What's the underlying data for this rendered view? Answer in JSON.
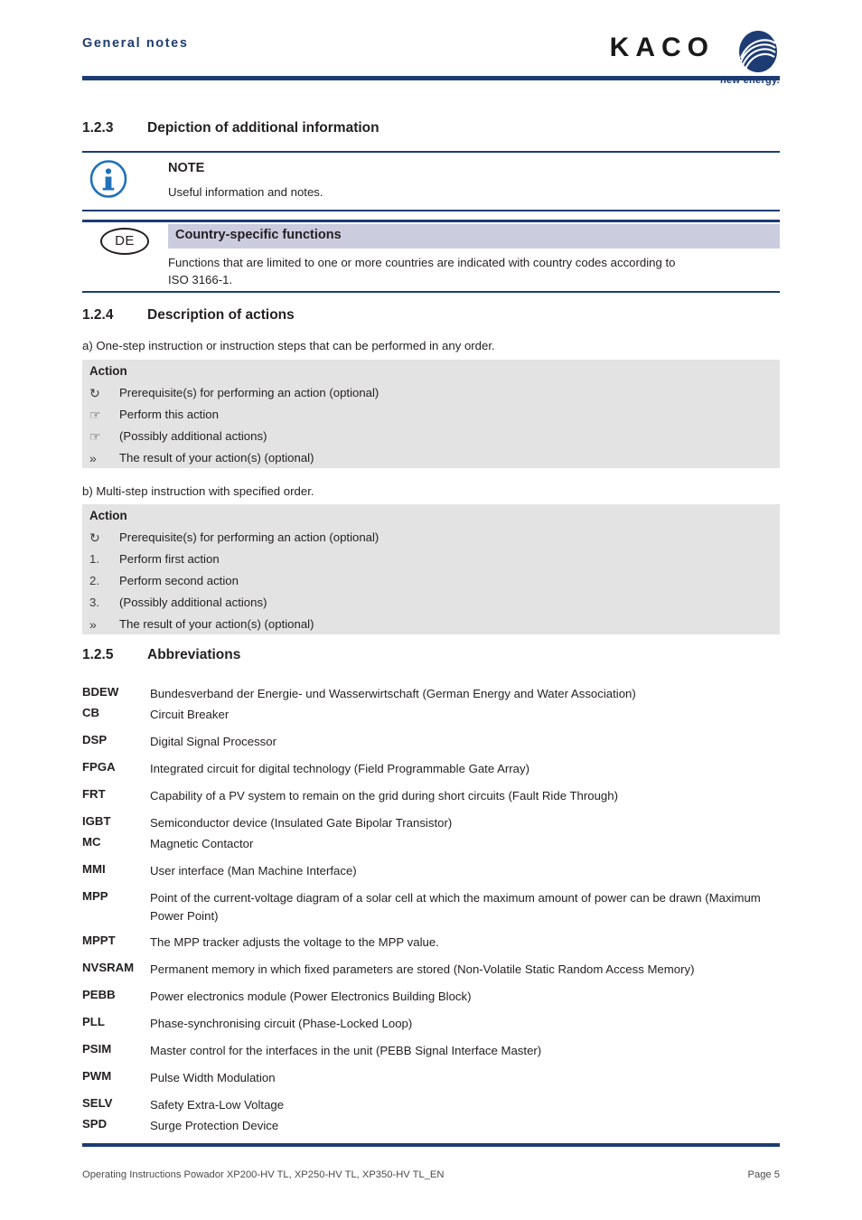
{
  "header": {
    "title": "General notes",
    "logo_word": "KACO",
    "logo_tagline": "new energy.",
    "accent_color": "#1d3c73"
  },
  "sections": {
    "s123": {
      "number": "1.2.3",
      "title": "Depiction of additional information"
    },
    "s124": {
      "number": "1.2.4",
      "title": "Description of actions"
    },
    "s125": {
      "number": "1.2.5",
      "title": "Abbreviations"
    }
  },
  "note_box": {
    "icon": "info-icon",
    "title": "NOTE",
    "body": "Useful information and notes."
  },
  "country_box": {
    "badge": "DE",
    "title": "Country-specific functions",
    "body_line1": "Functions that are limited to one or more countries are indicated with country codes according to",
    "body_line2": "ISO 3166-1.",
    "band_color": "#ccccdf"
  },
  "actions": {
    "intro_a": "a) One-step instruction or instruction steps that can be performed in any order.",
    "intro_b": "b) Multi-step instruction with specified order.",
    "box_a": {
      "heading": "Action",
      "rows": [
        {
          "marker": "↻",
          "text": "Prerequisite(s) for performing an action (optional)"
        },
        {
          "marker": "☞",
          "text": "Perform this action"
        },
        {
          "marker": "☞",
          "text": "(Possibly additional actions)"
        },
        {
          "marker": "»",
          "text": "The result of your action(s) (optional)"
        }
      ]
    },
    "box_b": {
      "heading": "Action",
      "rows": [
        {
          "marker": "↻",
          "text": "Prerequisite(s) for performing an action (optional)"
        },
        {
          "marker": "1.",
          "text": "Perform first action"
        },
        {
          "marker": "2.",
          "text": "Perform second action"
        },
        {
          "marker": "3.",
          "text": "(Possibly additional actions)"
        },
        {
          "marker": "»",
          "text": "The result of your action(s) (optional)"
        }
      ]
    },
    "box_color": "#e3e3e3"
  },
  "abbreviations": [
    {
      "key": "BDEW",
      "value": "Bundesverband der Energie- und Wasserwirtschaft (German Energy and Water Association)"
    },
    {
      "key": "CB",
      "value": "Circuit Breaker"
    },
    {
      "key": "DSP",
      "value": "Digital Signal Processor"
    },
    {
      "key": "FPGA",
      "value": "Integrated circuit for digital technology (Field Programmable Gate Array)"
    },
    {
      "key": "FRT",
      "value": "Capability of a PV system to remain on the grid during short circuits (Fault Ride Through)"
    },
    {
      "key": "IGBT",
      "value": "Semiconductor device  (Insulated Gate Bipolar Transistor)"
    },
    {
      "key": "MC",
      "value": "Magnetic Contactor"
    },
    {
      "key": "MMI",
      "value": "User interface (Man Machine Interface)"
    },
    {
      "key": "MPP",
      "value": "Point of the current-voltage diagram of a solar cell at which the maximum amount of power can be drawn (Maximum Power Point)"
    },
    {
      "key": "MPPT",
      "value": "The MPP tracker adjusts the voltage to the MPP value."
    },
    {
      "key": "NVSRAM",
      "value": "Permanent memory in which fixed parameters are stored (Non-Volatile Static Random Access Memory)"
    },
    {
      "key": "PEBB",
      "value": "Power electronics module (Power Electronics Building Block)"
    },
    {
      "key": "PLL",
      "value": "Phase-synchronising circuit (Phase-Locked Loop)"
    },
    {
      "key": "PSIM",
      "value": "Master control for the interfaces in the unit (PEBB Signal Interface Master)"
    },
    {
      "key": "PWM",
      "value": "Pulse Width Modulation"
    },
    {
      "key": "SELV",
      "value": "Safety Extra-Low Voltage"
    },
    {
      "key": "SPD",
      "value": "Surge Protection Device"
    }
  ],
  "footer": {
    "left": "Operating Instructions Powador XP200-HV TL, XP250-HV TL, XP350-HV TL_EN",
    "right": "Page 5"
  }
}
